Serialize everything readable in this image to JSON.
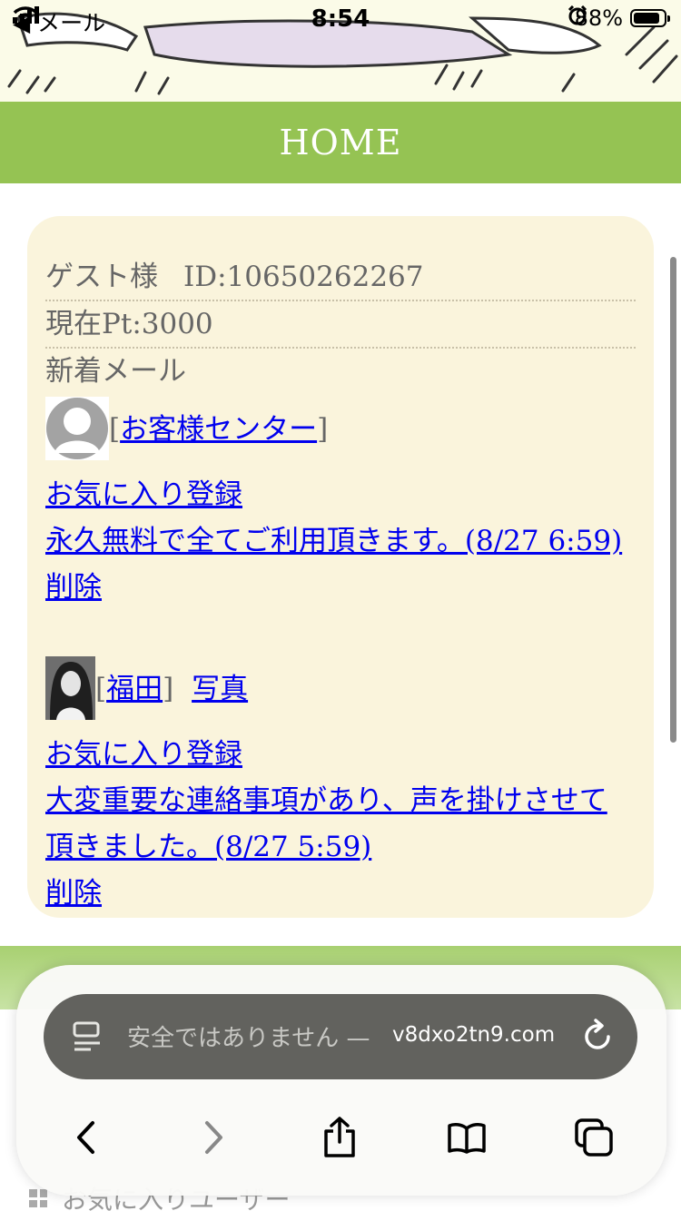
{
  "status_bar": {
    "back_app": "◀ メール",
    "time": "8:54",
    "battery_percent": "88%",
    "battery_level": 0.88
  },
  "header": {
    "title": "HOME"
  },
  "account": {
    "guest_label": "ゲスト様",
    "id_label": "ID:10650262267",
    "points_label": "現在Pt:3000",
    "new_mail_label": "新着メール"
  },
  "messages": [
    {
      "sender": "お客様センター",
      "favorite_label": "お気に入り登録",
      "body": "永久無料で全てご利用頂きます。(8/27 6:59)",
      "delete_label": "削除"
    },
    {
      "sender": "福田",
      "photo_label": "写真",
      "favorite_label": "お気に入り登録",
      "body_line1": "大変重要な連絡事項があり、声を掛けさせて",
      "body_line2": "頂きました。(8/27 5:59)",
      "delete_label": "削除"
    }
  ],
  "bottom_peek": {
    "label": "お気に入りユーザー"
  },
  "browser": {
    "url_warning": "安全ではありません —",
    "url_domain": "v8dxo2tn9.com",
    "toolbar_icons": [
      "back-icon",
      "forward-icon",
      "share-icon",
      "bookmarks-icon",
      "tabs-icon"
    ]
  }
}
